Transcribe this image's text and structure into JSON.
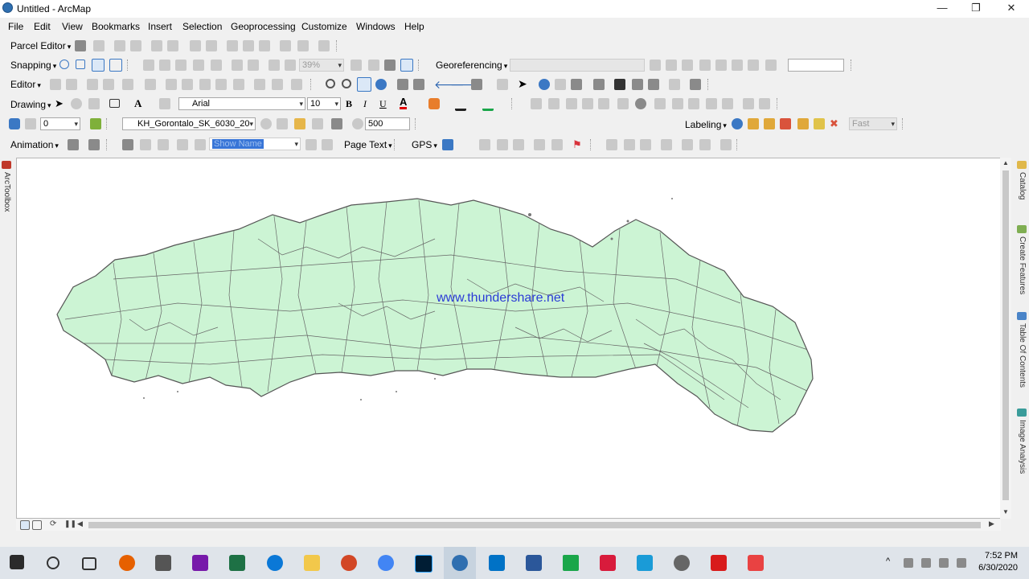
{
  "window": {
    "title": "Untitled - ArcMap",
    "minimize": "—",
    "maximize": "❐",
    "close": "✕"
  },
  "menu": [
    "File",
    "Edit",
    "View",
    "Bookmarks",
    "Insert",
    "Selection",
    "Geoprocessing",
    "Customize",
    "Windows",
    "Help"
  ],
  "toolbars": {
    "parcel_editor": "Parcel Editor",
    "snapping": "Snapping",
    "zoom_percent": "39%",
    "georeferencing": "Georeferencing",
    "editor": "Editor",
    "drawing": "Drawing",
    "font_name": "Arial",
    "font_size": "10",
    "bold": "B",
    "italic": "I",
    "underline": "U",
    "font_color_letter": "A",
    "text_tool_letter": "A",
    "tile_value": "0",
    "layer_name": "KH_Gorontalo_SK_6030_20",
    "scale_value": "500",
    "labeling": "Labeling",
    "label_speed": "Fast",
    "animation": "Animation",
    "show_name": "Show Name",
    "page_text": "Page Text",
    "gps": "GPS"
  },
  "map": {
    "watermark": "www.thundershare.net",
    "polygon_fill": "#ccf4d4",
    "polygon_stroke": "#555555"
  },
  "side_panels": {
    "left": "ArcToolbox",
    "right": [
      "Catalog",
      "Create Features",
      "Table Of Contents",
      "Image Analysis"
    ]
  },
  "taskbar": {
    "time": "7:52 PM",
    "date": "6/30/2020"
  }
}
